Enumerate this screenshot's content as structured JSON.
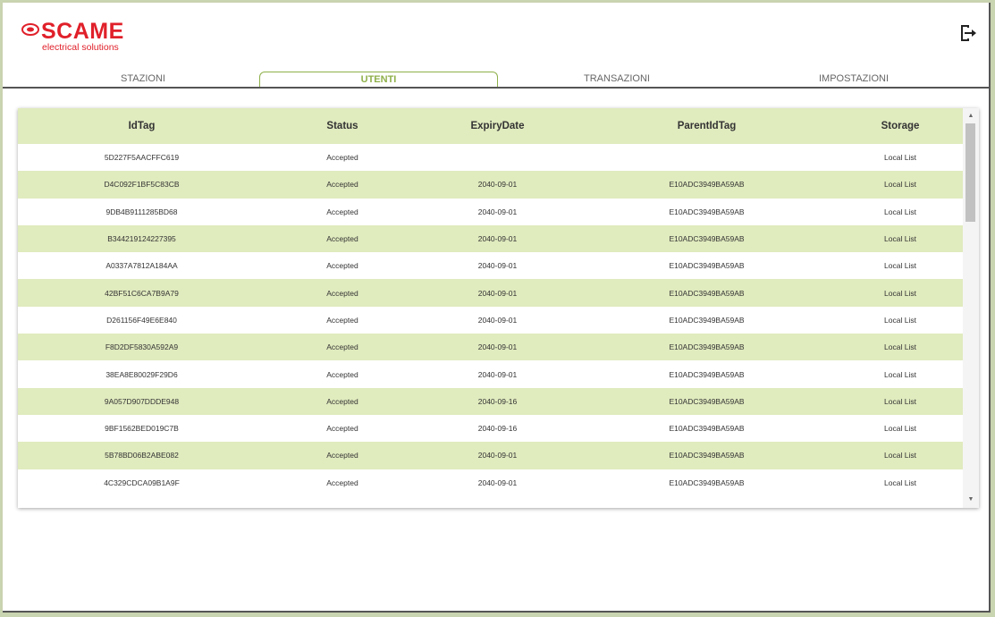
{
  "brand": {
    "name": "SCAME",
    "tagline": "electrical solutions",
    "color": "#e0202a"
  },
  "header": {
    "logout_icon": "logout-icon"
  },
  "tabs": [
    {
      "label": "STAZIONI",
      "active": false
    },
    {
      "label": "UTENTI",
      "active": true
    },
    {
      "label": "TRANSAZIONI",
      "active": false
    },
    {
      "label": "IMPOSTAZIONI",
      "active": false
    }
  ],
  "table": {
    "columns": [
      "IdTag",
      "Status",
      "ExpiryDate",
      "ParentIdTag",
      "Storage"
    ],
    "rows": [
      [
        "5D227F5AACFFC619",
        "Accepted",
        "",
        "",
        "Local List"
      ],
      [
        "D4C092F1BF5C83CB",
        "Accepted",
        "2040-09-01",
        "E10ADC3949BA59AB",
        "Local List"
      ],
      [
        "9DB4B9111285BD68",
        "Accepted",
        "2040-09-01",
        "E10ADC3949BA59AB",
        "Local List"
      ],
      [
        "B344219124227395",
        "Accepted",
        "2040-09-01",
        "E10ADC3949BA59AB",
        "Local List"
      ],
      [
        "A0337A7812A184AA",
        "Accepted",
        "2040-09-01",
        "E10ADC3949BA59AB",
        "Local List"
      ],
      [
        "42BF51C6CA7B9A79",
        "Accepted",
        "2040-09-01",
        "E10ADC3949BA59AB",
        "Local List"
      ],
      [
        "D261156F49E6E840",
        "Accepted",
        "2040-09-01",
        "E10ADC3949BA59AB",
        "Local List"
      ],
      [
        "F8D2DF5830A592A9",
        "Accepted",
        "2040-09-01",
        "E10ADC3949BA59AB",
        "Local List"
      ],
      [
        "38EA8E80029F29D6",
        "Accepted",
        "2040-09-01",
        "E10ADC3949BA59AB",
        "Local List"
      ],
      [
        "9A057D907DDDE948",
        "Accepted",
        "2040-09-16",
        "E10ADC3949BA59AB",
        "Local List"
      ],
      [
        "9BF1562BED019C7B",
        "Accepted",
        "2040-09-16",
        "E10ADC3949BA59AB",
        "Local List"
      ],
      [
        "5B78BD06B2ABE082",
        "Accepted",
        "2040-09-01",
        "E10ADC3949BA59AB",
        "Local List"
      ],
      [
        "4C329CDCA09B1A9F",
        "Accepted",
        "2040-09-01",
        "E10ADC3949BA59AB",
        "Local List"
      ]
    ]
  },
  "colors": {
    "accent": "#8fb04a",
    "row_alt": "#e0ebbe",
    "border": "#555555"
  }
}
